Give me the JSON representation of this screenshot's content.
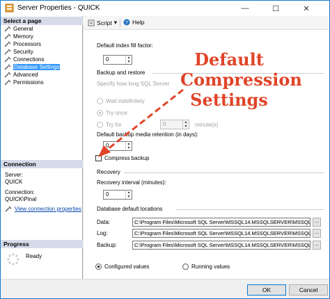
{
  "window": {
    "title": "Server Properties - QUICK"
  },
  "left_panel": {
    "select_page_heading": "Select a page",
    "pages": [
      {
        "label": "General",
        "selected": false
      },
      {
        "label": "Memory",
        "selected": false
      },
      {
        "label": "Processors",
        "selected": false
      },
      {
        "label": "Security",
        "selected": false
      },
      {
        "label": "Connections",
        "selected": false
      },
      {
        "label": "Database Settings",
        "selected": true
      },
      {
        "label": "Advanced",
        "selected": false
      },
      {
        "label": "Permissions",
        "selected": false
      }
    ],
    "connection_heading": "Connection",
    "server_label": "Server:",
    "server_value": "QUICK",
    "connection_label": "Connection:",
    "connection_value": "QUICK\\Pinal",
    "view_link": "View connection properties",
    "progress_heading": "Progress",
    "progress_status": "Ready"
  },
  "toolbar": {
    "script_label": "Script",
    "help_label": "Help"
  },
  "settings": {
    "fill_factor_label": "Default index fill factor:",
    "fill_factor_value": "0",
    "backup_restore_heading": "Backup and restore",
    "specify_label": "Specify how long SQL Server",
    "wait_indefinitely": "Wait indefinitely",
    "try_once": "Try once",
    "try_for": "Try for",
    "try_for_value": "0",
    "minutes_label": "minute(s)",
    "retention_label": "Default backup media retention (in days):",
    "retention_value": "0",
    "compress_backup": "Compress backup",
    "compress_backup_checked": false,
    "recovery_heading": "Recovery",
    "recovery_interval_label": "Recovery interval (minutes):",
    "recovery_interval_value": "0",
    "locations_heading": "Database default locations",
    "data_label": "Data:",
    "data_path": "C:\\Program Files\\Microsoft SQL Server\\MSSQL14.MSSQLSERVER\\MSSQL",
    "log_label": "Log:",
    "log_path": "C:\\Program Files\\Microsoft SQL Server\\MSSQL14.MSSQLSERVER\\MSSQL",
    "backup_label": "Backup:",
    "backup_path": "C:\\Program Files\\Microsoft SQL Server\\MSSQL14.MSSQLSERVER\\MSSQL",
    "browse_label": "...",
    "configured_values": "Configured values",
    "running_values": "Running values",
    "selected_view": "configured"
  },
  "buttons": {
    "ok": "OK",
    "cancel": "Cancel"
  },
  "annotation": {
    "line1": "Default",
    "line2": "Compression",
    "line3": "Settings",
    "color": "#e04428"
  },
  "colors": {
    "selection": "#3399ff",
    "section_header": "#d6dbe9",
    "link": "#0645ad"
  }
}
